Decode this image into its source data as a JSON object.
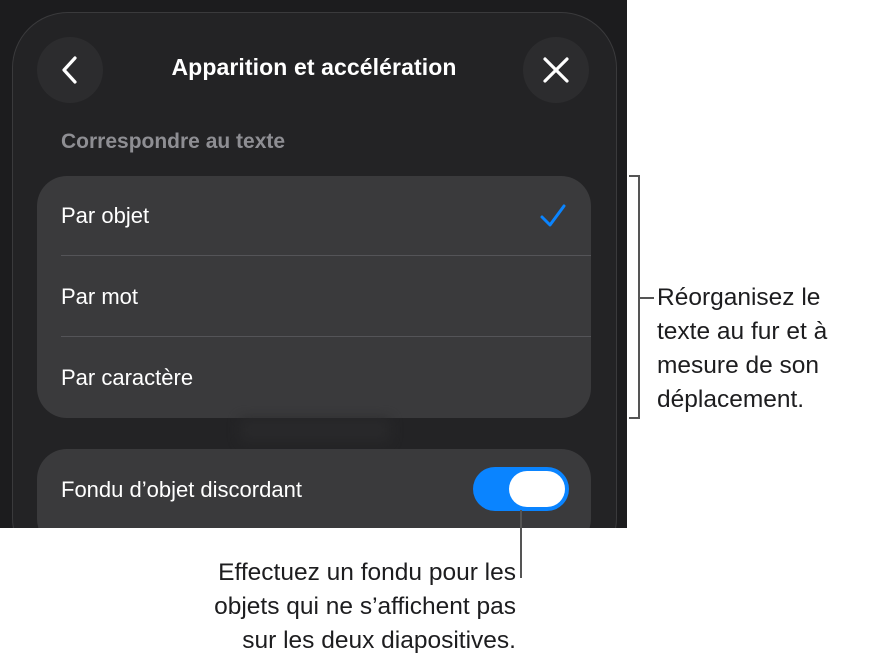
{
  "header": {
    "title": "Apparition et accélération",
    "back_icon": "chevron-left-icon",
    "close_icon": "xmark-icon"
  },
  "section": {
    "header": "Correspondre au texte",
    "options": [
      {
        "label": "Par objet",
        "selected": true
      },
      {
        "label": "Par mot",
        "selected": false
      },
      {
        "label": "Par caractère",
        "selected": false
      }
    ]
  },
  "toggle": {
    "label": "Fondu d’objet discordant",
    "on": true
  },
  "callouts": {
    "right_lines": [
      "Réorganisez le",
      "texte au fur et à",
      "mesure de son",
      "déplacement."
    ],
    "bottom_lines": [
      "Effectuez un fondu pour les",
      "objets qui ne s’affichent pas",
      "sur les deux diapositives."
    ]
  },
  "colors": {
    "accent": "#0a84ff",
    "background": "#1c1c1e",
    "group_background": "#3a3a3c",
    "secondary_text": "#8e8e93"
  }
}
